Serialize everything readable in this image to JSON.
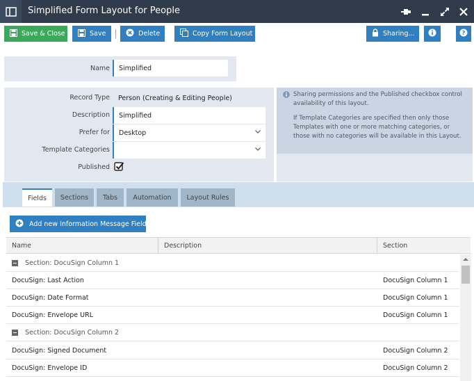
{
  "window": {
    "title": "Simplified Form Layout for People"
  },
  "toolbar": {
    "save_close": "Save & Close",
    "save": "Save",
    "delete": "Delete",
    "copy": "Copy Form Layout",
    "sharing": "Sharing..."
  },
  "form": {
    "name_label": "Name",
    "name_value": "Simplified",
    "record_type_label": "Record Type",
    "record_type_value": "Person (Creating & Editing People)",
    "description_label": "Description",
    "description_value": "Simplified",
    "prefer_for_label": "Prefer for",
    "prefer_for_value": "Desktop",
    "template_categories_label": "Template Categories",
    "template_categories_value": "",
    "published_label": "Published",
    "published_checked": true
  },
  "info": {
    "p1": "Sharing permissions and the Published checkbox control availability of this layout.",
    "p2": "If Template Categories are specified then only those Templates with one or more matching categories, or those with no categories will be available in this Layout."
  },
  "tabs": [
    {
      "label": "Fields",
      "active": true
    },
    {
      "label": "Sections",
      "active": false
    },
    {
      "label": "Tabs",
      "active": false
    },
    {
      "label": "Automation",
      "active": false
    },
    {
      "label": "Layout Rules",
      "active": false
    }
  ],
  "grid": {
    "add_button": "Add new Information Message Field",
    "columns": [
      "Name",
      "Description",
      "Section"
    ],
    "rows": [
      {
        "type": "section",
        "name": "Section: DocuSign Column 1"
      },
      {
        "type": "field",
        "name": "DocuSign: Last Action",
        "description": "",
        "section": "DocuSign Column 1"
      },
      {
        "type": "field",
        "name": "DocuSign: Date Format",
        "description": "",
        "section": "DocuSign Column 1"
      },
      {
        "type": "field",
        "name": "DocuSign: Envelope URL",
        "description": "",
        "section": "DocuSign Column 1"
      },
      {
        "type": "section",
        "name": "Section: DocuSign Column 2"
      },
      {
        "type": "field",
        "name": "DocuSign: Signed Document",
        "description": "",
        "section": "DocuSign Column 2"
      },
      {
        "type": "field",
        "name": "DocuSign: Envelope ID",
        "description": "",
        "section": "DocuSign Column 2"
      }
    ]
  },
  "colors": {
    "accent": "#2f7fc1",
    "success": "#3aaa5a",
    "titlebar": "#2f3a4a"
  }
}
